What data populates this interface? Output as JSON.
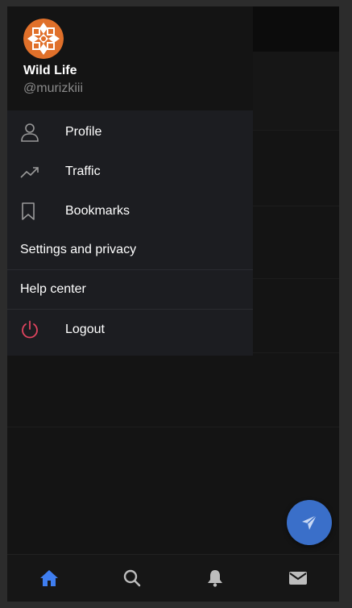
{
  "user": {
    "name": "Wild Life",
    "handle": "@murizkiii"
  },
  "menu": {
    "profile": "Profile",
    "traffic": "Traffic",
    "bookmarks": "Bookmarks",
    "settings": "Settings and privacy",
    "help": "Help center",
    "logout": "Logout"
  },
  "icons": {
    "profile": "person-icon",
    "traffic": "trending-up-icon",
    "bookmarks": "bookmark-icon",
    "logout": "power-icon",
    "nav": [
      "home-icon",
      "search-icon",
      "bell-icon",
      "mail-icon"
    ],
    "fab": "send-icon"
  },
  "colors": {
    "drawer_bg": "#1c1d21",
    "header_bg": "#141414",
    "accent": "#3f7ef0",
    "fab": "#3a6fc9",
    "logout_icon": "#e0445f",
    "avatar": "#e0702a",
    "icon_gray": "#9a9a9a"
  }
}
